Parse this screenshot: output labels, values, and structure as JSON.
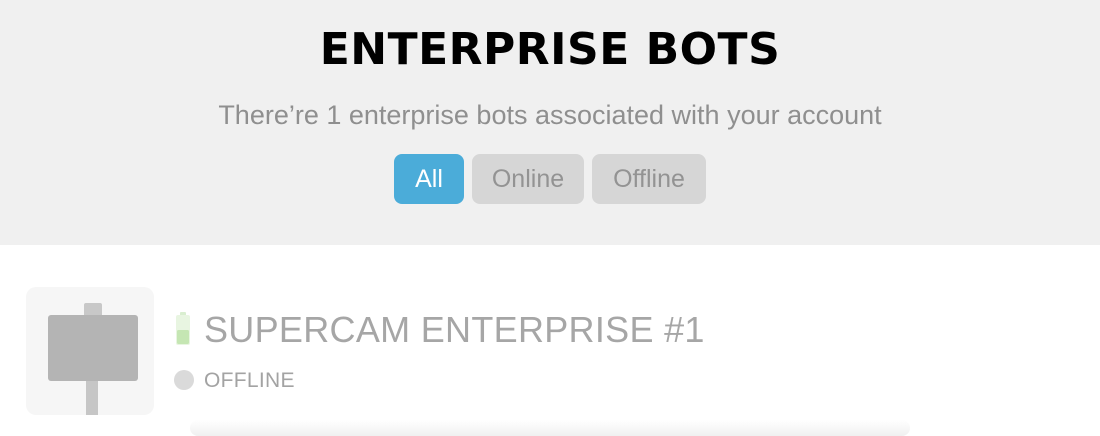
{
  "header": {
    "title": "ENTERPRISE BOTS",
    "subtitle": "There’re 1 enterprise bots associated with your account",
    "filters": [
      {
        "label": "All",
        "active": true
      },
      {
        "label": "Online",
        "active": false
      },
      {
        "label": "Offline",
        "active": false
      }
    ]
  },
  "bots": [
    {
      "name": "SUPERCAM ENTERPRISE #1",
      "status": "OFFLINE",
      "thumbnail_icon": "supercam-device-icon",
      "battery_icon": "battery-icon",
      "status_icon": "status-dot-icon"
    }
  ],
  "colors": {
    "accent": "#4bacd9",
    "header_bg": "#f0f0f0",
    "inactive_button": "#d6d6d6",
    "battery": "#c5e6b3",
    "offline_dot": "#dadada"
  }
}
